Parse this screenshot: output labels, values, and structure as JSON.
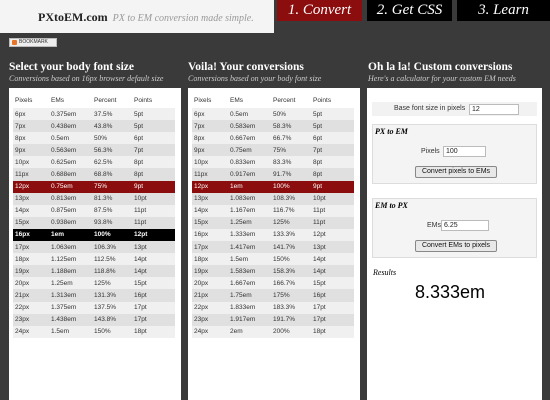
{
  "header": {
    "logo_name": "PXtoEM.com",
    "logo_tagline": "PX to EM conversion made simple.",
    "tabs": [
      {
        "label": "1. Convert",
        "active": true
      },
      {
        "label": "2. Get CSS",
        "active": false
      },
      {
        "label": "3. Learn",
        "active": false
      }
    ],
    "bookmark_label": "BOOKMARK"
  },
  "col1": {
    "title": "Select your body font size",
    "subtitle": "Conversions based on 16px browser default size",
    "headers": [
      "Pixels",
      "EMs",
      "Percent",
      "Points"
    ],
    "rows": [
      [
        "6px",
        "0.375em",
        "37.5%",
        "5pt"
      ],
      [
        "7px",
        "0.438em",
        "43.8%",
        "5pt"
      ],
      [
        "8px",
        "0.5em",
        "50%",
        "6pt"
      ],
      [
        "9px",
        "0.563em",
        "56.3%",
        "7pt"
      ],
      [
        "10px",
        "0.625em",
        "62.5%",
        "8pt"
      ],
      [
        "11px",
        "0.688em",
        "68.8%",
        "8pt"
      ],
      [
        "12px",
        "0.75em",
        "75%",
        "9pt"
      ],
      [
        "13px",
        "0.813em",
        "81.3%",
        "10pt"
      ],
      [
        "14px",
        "0.875em",
        "87.5%",
        "11pt"
      ],
      [
        "15px",
        "0.938em",
        "93.8%",
        "11pt"
      ],
      [
        "16px",
        "1em",
        "100%",
        "12pt"
      ],
      [
        "17px",
        "1.063em",
        "106.3%",
        "13pt"
      ],
      [
        "18px",
        "1.125em",
        "112.5%",
        "14pt"
      ],
      [
        "19px",
        "1.188em",
        "118.8%",
        "14pt"
      ],
      [
        "20px",
        "1.25em",
        "125%",
        "15pt"
      ],
      [
        "21px",
        "1.313em",
        "131.3%",
        "16pt"
      ],
      [
        "22px",
        "1.375em",
        "137.5%",
        "17pt"
      ],
      [
        "23px",
        "1.438em",
        "143.8%",
        "17pt"
      ],
      [
        "24px",
        "1.5em",
        "150%",
        "18pt"
      ]
    ],
    "selected_row": 6,
    "base_row": 10
  },
  "col2": {
    "title": "Voila! Your conversions",
    "subtitle": "Conversions based on your body font size",
    "headers": [
      "Pixels",
      "EMs",
      "Percent",
      "Points"
    ],
    "rows": [
      [
        "6px",
        "0.5em",
        "50%",
        "5pt"
      ],
      [
        "7px",
        "0.583em",
        "58.3%",
        "5pt"
      ],
      [
        "8px",
        "0.667em",
        "66.7%",
        "6pt"
      ],
      [
        "9px",
        "0.75em",
        "75%",
        "7pt"
      ],
      [
        "10px",
        "0.833em",
        "83.3%",
        "8pt"
      ],
      [
        "11px",
        "0.917em",
        "91.7%",
        "8pt"
      ],
      [
        "12px",
        "1em",
        "100%",
        "9pt"
      ],
      [
        "13px",
        "1.083em",
        "108.3%",
        "10pt"
      ],
      [
        "14px",
        "1.167em",
        "116.7%",
        "11pt"
      ],
      [
        "15px",
        "1.25em",
        "125%",
        "11pt"
      ],
      [
        "16px",
        "1.333em",
        "133.3%",
        "12pt"
      ],
      [
        "17px",
        "1.417em",
        "141.7%",
        "13pt"
      ],
      [
        "18px",
        "1.5em",
        "150%",
        "14pt"
      ],
      [
        "19px",
        "1.583em",
        "158.3%",
        "14pt"
      ],
      [
        "20px",
        "1.667em",
        "166.7%",
        "15pt"
      ],
      [
        "21px",
        "1.75em",
        "175%",
        "16pt"
      ],
      [
        "22px",
        "1.833em",
        "183.3%",
        "17pt"
      ],
      [
        "23px",
        "1.917em",
        "191.7%",
        "17pt"
      ],
      [
        "24px",
        "2em",
        "200%",
        "18pt"
      ]
    ],
    "selected_row": 6
  },
  "col3": {
    "title": "Oh la la! Custom conversions",
    "subtitle": "Here's a calculator for your custom EM needs",
    "base_label": "Base font size in pixels",
    "base_value": "12",
    "px_to_em": {
      "title": "PX to EM",
      "label": "Pixels",
      "value": "100",
      "button": "Convert pixels to EMs"
    },
    "em_to_px": {
      "title": "EM to PX",
      "label": "EMs",
      "value": "6.25",
      "button": "Convert EMs to pixels"
    },
    "results_label": "Results",
    "results_value": "8.333em"
  },
  "colors": {
    "accent": "#8c0d0d",
    "background": "#3a3a3a",
    "base_row": "#000000"
  }
}
